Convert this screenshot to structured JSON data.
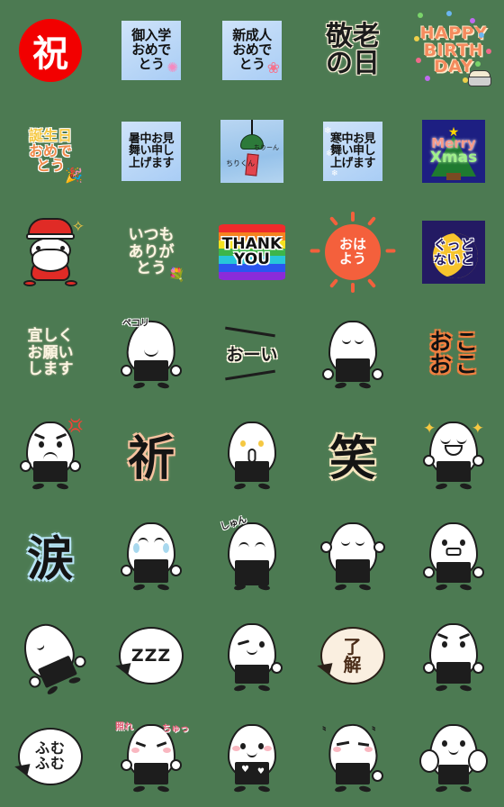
{
  "page": {
    "title": "Emoji sticker grid",
    "background_color": "#4c7a52",
    "columns": 5,
    "rows": 8,
    "total_items": 40
  },
  "palette": {
    "background": "#4c7a52",
    "stamp_red": "#f20000",
    "card_blue": "#bcd8f7",
    "xmas_navy": "#1d1f82",
    "night_indigo": "#231a63",
    "moon_yellow": "#f7c42c",
    "sun_orange": "#f4603c",
    "peach_outline": "#f7c3a0",
    "cream_outline": "#f6e7bf",
    "tear_blue": "#b8e4f5",
    "okoko_orange": "#f08040",
    "ink_black": "#1d1d1d",
    "paper_white": "#ffffff",
    "bubble_cream": "#faefe0"
  },
  "items": [
    {
      "id": 1,
      "name": "shuku-stamp",
      "type": "stamp",
      "text": "祝"
    },
    {
      "id": 2,
      "name": "school-entrance-card",
      "type": "card-blue",
      "lines": [
        "御入学",
        "おめで",
        "とう"
      ],
      "decoration": "sakura-flower"
    },
    {
      "id": 3,
      "name": "coming-of-age-card",
      "type": "card-blue",
      "lines": [
        "新成人",
        "おめで",
        "とう"
      ],
      "decoration": "camellia-flower"
    },
    {
      "id": 4,
      "name": "respect-aged-day-card",
      "type": "kanji",
      "lines": [
        "敬老",
        "の日"
      ]
    },
    {
      "id": 5,
      "name": "happy-birthday-card",
      "type": "birthday",
      "lines": [
        "HAPPY",
        "BIRTH",
        "DAY"
      ],
      "decoration": "cake-and-confetti"
    },
    {
      "id": 6,
      "name": "birthday-kana-card",
      "type": "bday-kana",
      "lines": [
        "誕生日",
        "おめで",
        "とう"
      ],
      "decoration": "party-popper"
    },
    {
      "id": 7,
      "name": "summer-greeting-card",
      "type": "card-blue",
      "lines": [
        "暑中お見",
        "舞い申し",
        "上げます"
      ]
    },
    {
      "id": 8,
      "name": "wind-chime-card",
      "type": "fuurin",
      "labels": [
        "ちりーん",
        "ちりくん"
      ]
    },
    {
      "id": 9,
      "name": "winter-greeting-card",
      "type": "card-blue",
      "lines": [
        "寒中お見",
        "舞い申し",
        "上げます"
      ],
      "decoration": "snowflakes"
    },
    {
      "id": 10,
      "name": "merry-xmas-card",
      "type": "xmas",
      "lines": [
        "Merry",
        "Xmas"
      ]
    },
    {
      "id": 11,
      "name": "santa-claus",
      "type": "santa",
      "text": ""
    },
    {
      "id": 12,
      "name": "thanks-always-card",
      "type": "kana-cream",
      "lines": [
        "いつも",
        "ありが",
        "とう"
      ],
      "decoration": "bouquet"
    },
    {
      "id": 13,
      "name": "thank-you-rainbow",
      "type": "rainbow",
      "lines": [
        "THANK",
        "YOU"
      ]
    },
    {
      "id": 14,
      "name": "good-morning-sun",
      "type": "sun",
      "lines": [
        "おは",
        "よう"
      ]
    },
    {
      "id": 15,
      "name": "good-night-moon",
      "type": "gnight",
      "lines": [
        "ぐっど",
        "ないと"
      ]
    },
    {
      "id": 16,
      "name": "please-regards-card",
      "type": "kana-cream",
      "lines": [
        "宜しく",
        "お願い",
        "します"
      ]
    },
    {
      "id": 17,
      "name": "onigiri-bowing",
      "type": "onigiri",
      "tag": "ペコリ",
      "mood": "bowing"
    },
    {
      "id": 18,
      "name": "ooi-shout",
      "type": "ooi",
      "text": "おーい"
    },
    {
      "id": 19,
      "name": "onigiri-pleading",
      "type": "onigiri",
      "tag": "",
      "mood": "pleading"
    },
    {
      "id": 20,
      "name": "okoko-angry-text",
      "type": "oko",
      "chars": [
        "お",
        "こ",
        "お",
        "こ"
      ]
    },
    {
      "id": 21,
      "name": "onigiri-angry",
      "type": "onigiri",
      "tag": "",
      "mood": "angry"
    },
    {
      "id": 22,
      "name": "inori-kanji",
      "type": "big-kanji",
      "text": "祈",
      "outline": "peach"
    },
    {
      "id": 23,
      "name": "onigiri-praying",
      "type": "onigiri",
      "tag": "",
      "mood": "praying"
    },
    {
      "id": 24,
      "name": "warai-kanji",
      "type": "big-kanji",
      "text": "笑",
      "outline": "cream"
    },
    {
      "id": 25,
      "name": "onigiri-excited",
      "type": "onigiri",
      "tag": "",
      "mood": "excited"
    },
    {
      "id": 26,
      "name": "namida-kanji",
      "type": "big-kanji",
      "text": "涙",
      "outline": "blue"
    },
    {
      "id": 27,
      "name": "onigiri-crying",
      "type": "onigiri",
      "tag": "",
      "mood": "crying"
    },
    {
      "id": 28,
      "name": "onigiri-dejected",
      "type": "onigiri",
      "tag": "しゅん",
      "mood": "dejected"
    },
    {
      "id": 29,
      "name": "onigiri-cheering",
      "type": "onigiri",
      "tag": "",
      "mood": "cheering"
    },
    {
      "id": 30,
      "name": "onigiri-surprised",
      "type": "onigiri",
      "tag": "",
      "mood": "surprised"
    },
    {
      "id": 31,
      "name": "onigiri-sleepy-lean",
      "type": "onigiri",
      "tag": "",
      "mood": "sleepy-lean"
    },
    {
      "id": 32,
      "name": "zzz-bubble",
      "type": "bubble",
      "text": "ZZZ"
    },
    {
      "id": 33,
      "name": "onigiri-winking",
      "type": "onigiri",
      "tag": "",
      "mood": "winking"
    },
    {
      "id": 34,
      "name": "ryoukai-bubble",
      "type": "bubble-cream",
      "lines": [
        "了",
        "解"
      ]
    },
    {
      "id": 35,
      "name": "onigiri-thinking",
      "type": "onigiri",
      "tag": "",
      "mood": "thinking"
    },
    {
      "id": 36,
      "name": "fumufumu-bubble",
      "type": "bubble",
      "lines": [
        "ふむ",
        "ふむ"
      ]
    },
    {
      "id": 37,
      "name": "onigiri-shy-kiss",
      "type": "onigiri",
      "tags": [
        "照れ",
        "ちゅっ"
      ],
      "mood": "shy-kiss"
    },
    {
      "id": 38,
      "name": "onigiri-love",
      "type": "onigiri",
      "tag": "",
      "mood": "love"
    },
    {
      "id": 39,
      "name": "onigiri-flustered",
      "type": "onigiri",
      "tag": "",
      "mood": "flustered"
    },
    {
      "id": 40,
      "name": "onigiri-hands-up",
      "type": "onigiri",
      "tag": "",
      "mood": "hands-up"
    }
  ]
}
